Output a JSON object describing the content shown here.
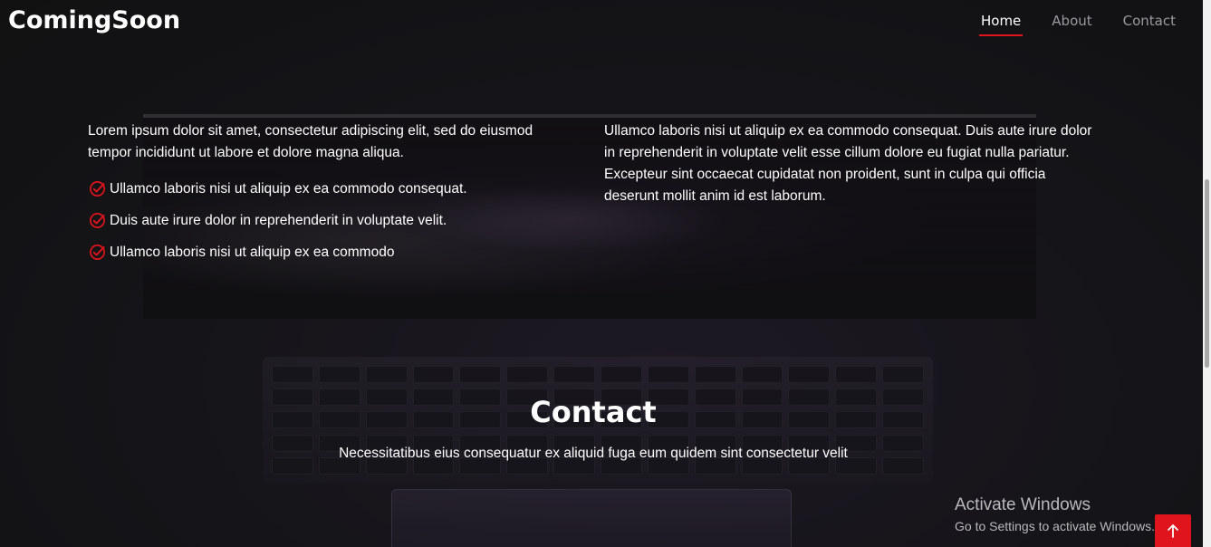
{
  "header": {
    "logo": "ComingSoon",
    "nav": [
      {
        "label": "Home",
        "active": true
      },
      {
        "label": "About",
        "active": false
      },
      {
        "label": "Contact",
        "active": false
      }
    ]
  },
  "about": {
    "left_paragraph": "Lorem ipsum dolor sit amet, consectetur adipiscing elit, sed do eiusmod tempor incididunt ut labore et dolore magna aliqua.",
    "checklist": [
      "Ullamco laboris nisi ut aliquip ex ea commodo consequat.",
      "Duis aute irure dolor in reprehenderit in voluptate velit.",
      "Ullamco laboris nisi ut aliquip ex ea commodo"
    ],
    "right_paragraph": "Ullamco laboris nisi ut aliquip ex ea commodo consequat. Duis aute irure dolor in reprehenderit in voluptate velit esse cillum dolore eu fugiat nulla pariatur. Excepteur sint occaecat cupidatat non proident, sunt in culpa qui officia deserunt mollit anim id est laborum."
  },
  "contact": {
    "title": "Contact",
    "subtitle": "Necessitatibus eius consequatur ex aliquid fuga eum quidem sint consectetur velit"
  },
  "watermark": {
    "line1": "Activate Windows",
    "line2": "Go to Settings to activate Windows."
  },
  "icons": {
    "check": "check-circle-icon",
    "back_to_top": "arrow-up-icon"
  },
  "colors": {
    "accent": "#e0141c",
    "background": "#151517",
    "text": "#ffffff",
    "nav_inactive": "#9a9a9e"
  }
}
